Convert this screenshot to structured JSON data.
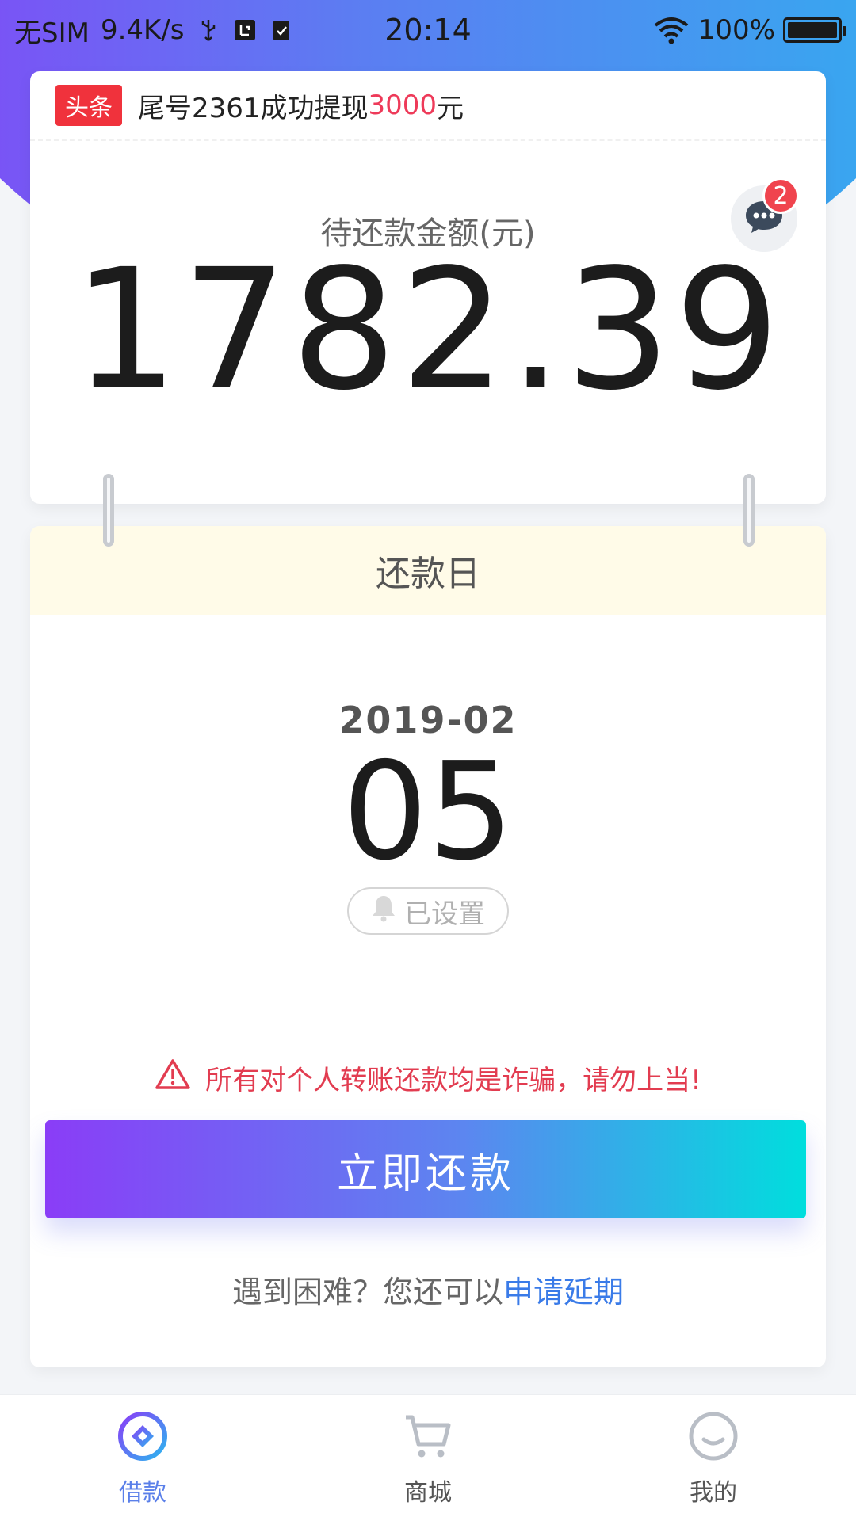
{
  "status_bar": {
    "carrier": "无SIM",
    "speed": "9.4K/s",
    "time": "20:14",
    "battery": "100%",
    "battery_level": 1.0
  },
  "news": {
    "tag": "头条",
    "text_prefix": "尾号2361成功提现",
    "amount": "3000",
    "text_suffix": "元"
  },
  "summary": {
    "label": "待还款金额(元)",
    "amount": "1782.39",
    "message_badge": "2"
  },
  "due": {
    "header": "还款日",
    "year_month": "2019-02",
    "day": "05",
    "reminder_label": "已设置"
  },
  "warning": {
    "text": "所有对个人转账还款均是诈骗，请勿上当!"
  },
  "actions": {
    "pay_now": "立即还款",
    "extend_prefix": "遇到困难？您还可以",
    "extend_link": "申请延期"
  },
  "nav": {
    "items": [
      {
        "label": "借款",
        "icon": "loan-icon",
        "active": true
      },
      {
        "label": "商城",
        "icon": "cart-icon",
        "active": false
      },
      {
        "label": "我的",
        "icon": "smile-icon",
        "active": false
      }
    ]
  },
  "colors": {
    "accent_blue": "#5a7fe9",
    "warning_red": "#e23c50",
    "gradient_start": "#8a3df7",
    "gradient_end": "#00dedd"
  }
}
